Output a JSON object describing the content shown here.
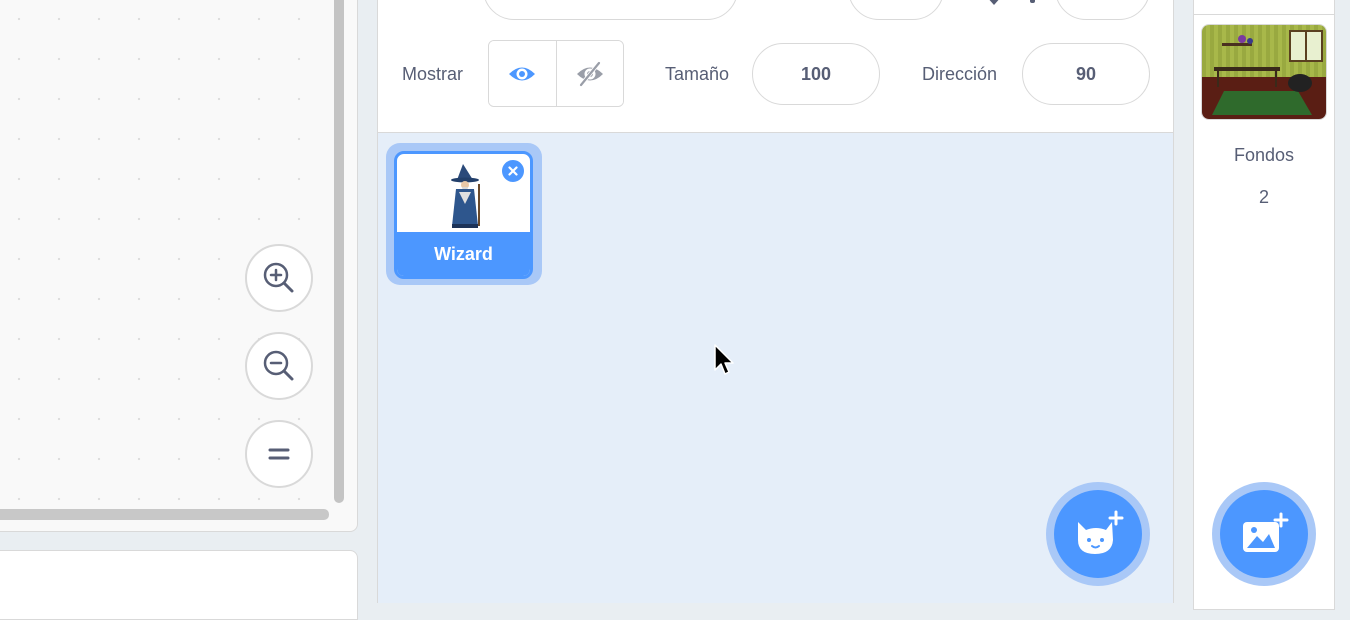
{
  "sprite_info": {
    "show_label": "Mostrar",
    "size_label": "Tamaño",
    "size_value": "100",
    "direction_label": "Dirección",
    "direction_value": "90"
  },
  "sprites": [
    {
      "name": "Wizard"
    }
  ],
  "stage": {
    "backdrops_label": "Fondos",
    "backdrops_count": "2"
  },
  "colors": {
    "accent": "#4c97ff",
    "accent_halo": "#a9c8f7",
    "sprite_list_bg": "#e5eef9",
    "text": "#575e75"
  }
}
